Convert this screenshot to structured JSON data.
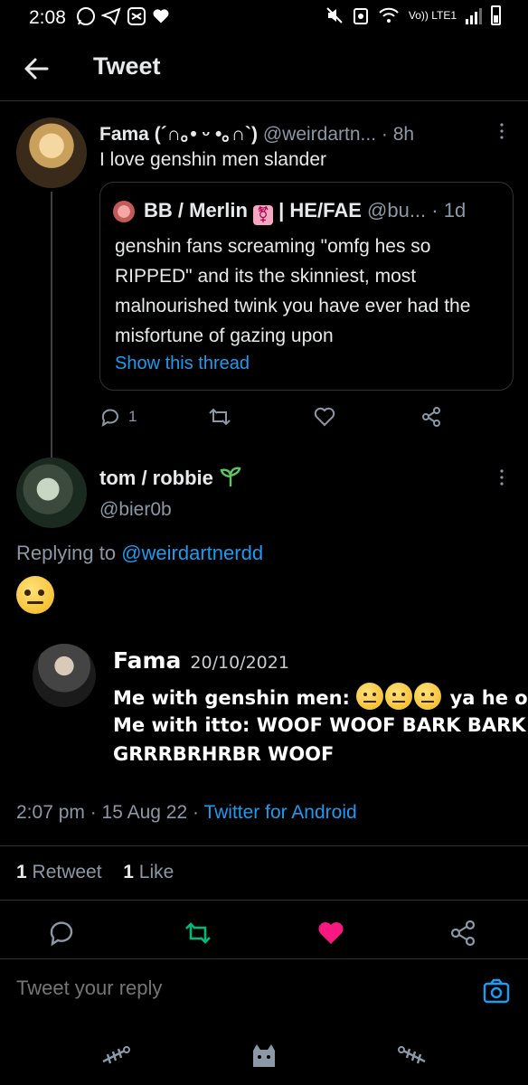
{
  "status_bar": {
    "time": "2:08",
    "network": "Vo)) LTE1"
  },
  "header": {
    "title": "Tweet"
  },
  "tweet1": {
    "name": "Fama (´∩｡• ᵕ •｡∩`)",
    "handle": "@weirdartn...",
    "time": "· 8h",
    "text": "I love genshin men slander",
    "quote": {
      "name": "BB / Merlin",
      "pronouns": "| HE/FAE",
      "handle": "@bu...",
      "time": "· 1d",
      "text": "genshin fans screaming \"omfg hes so RIPPED\" and its the skinniest, most malnourished twink you have ever had the misfortune of gazing upon",
      "show_thread": "Show this thread"
    },
    "reply_count": "1"
  },
  "tweet2": {
    "name": "tom / robbie",
    "handle": "@bier0b",
    "replying_prefix": "Replying to",
    "replying_handle": "@weirdartnerdd",
    "embed": {
      "name": "Fama",
      "date": "20/10/2021",
      "line1_prefix": "Me with genshin men:",
      "line1_suffix": "ya he ok",
      "line2": "Me with itto: WOOF WOOF BARK BARK",
      "line3": "GRRRBRHRBR WOOF"
    },
    "timestamp": "2:07 pm · 15 Aug 22 ·",
    "source": "Twitter for Android",
    "retweet_count": "1",
    "retweet_label": "Retweet",
    "like_count": "1",
    "like_label": "Like"
  },
  "reply": {
    "placeholder": "Tweet your reply"
  },
  "colors": {
    "accent": "#1d9bf0",
    "retweet": "#00ba7c",
    "like": "#f91880",
    "muted": "#8b98a5"
  }
}
